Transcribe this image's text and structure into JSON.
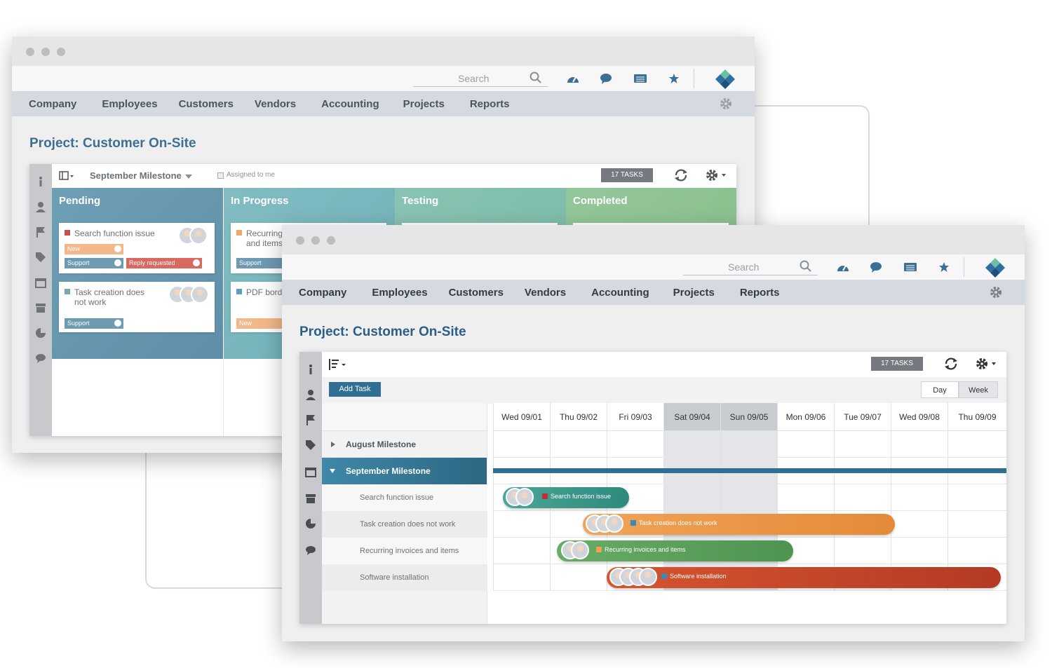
{
  "back_window": {
    "search": {
      "placeholder": "Search"
    },
    "nav": [
      "Company",
      "Employees",
      "Customers",
      "Vendors",
      "Accounting",
      "Projects",
      "Reports"
    ],
    "page_title": "Project: Customer On-Site",
    "toolbar": {
      "milestone": "September Milestone",
      "assigned": "Assigned to me",
      "tasks": "17 TASKS"
    },
    "columns": [
      {
        "name": "Pending",
        "color": "#6f9fb6"
      },
      {
        "name": "In Progress",
        "color": "#7fb8bd"
      },
      {
        "name": "Testing",
        "color": "#83bfae"
      },
      {
        "name": "Completed",
        "color": "#8cc28c"
      }
    ],
    "cards": [
      {
        "title": "Search function issue",
        "color": "#c65158",
        "tags": [
          "New",
          "Support",
          "Reply requested"
        ]
      },
      {
        "title": "Task creation does",
        "title2": "not work",
        "color": "#7ea3b9",
        "tags": [
          "Support"
        ]
      },
      {
        "title": "Recurring",
        "title2": "and items",
        "color": "#f0a66a",
        "tags": [
          "Support"
        ]
      },
      {
        "title": "PDF bord",
        "color": "#5b9ec0",
        "tags": [
          "New"
        ]
      }
    ]
  },
  "front_window": {
    "search": {
      "placeholder": "Search"
    },
    "nav": [
      "Company",
      "Employees",
      "Customers",
      "Vendors",
      "Accounting",
      "Projects",
      "Reports"
    ],
    "page_title": "Project: Customer On-Site",
    "toolbar": {
      "tasks": "17 TASKS",
      "add_task": "Add Task",
      "day": "Day",
      "week": "Week"
    },
    "days": [
      "Wed 09/01",
      "Thu 09/02",
      "Fri 09/03",
      "Sat 09/04",
      "Sun 09/05",
      "Mon 09/06",
      "Tue 09/07",
      "Wed 09/08",
      "Thu 09/09"
    ],
    "weekend_days": [
      "Sat 09/04",
      "Sun 09/05"
    ],
    "milestones": [
      "August Milestone",
      "September Milestone"
    ],
    "tasks": [
      {
        "name": "Search function issue",
        "bar_label": "Search function issue",
        "color": "#3e9a8a",
        "marker": "#c0303a"
      },
      {
        "name": "Task creation does not work",
        "bar_label": "Task creation does not work",
        "color": "#ea9a4a",
        "marker": "#3a8ab8"
      },
      {
        "name": "Recurring invoices and items",
        "bar_label": "Recurring invoices and items",
        "color": "#5aa05a",
        "marker": "#f0a050"
      },
      {
        "name": "Software installation",
        "bar_label": "Software installation",
        "color": "#cc4a2e",
        "marker": "#3a8ab8"
      }
    ],
    "colors": {
      "accent": "#3d6f93",
      "milestone_bar": "#2f6f8f"
    }
  }
}
